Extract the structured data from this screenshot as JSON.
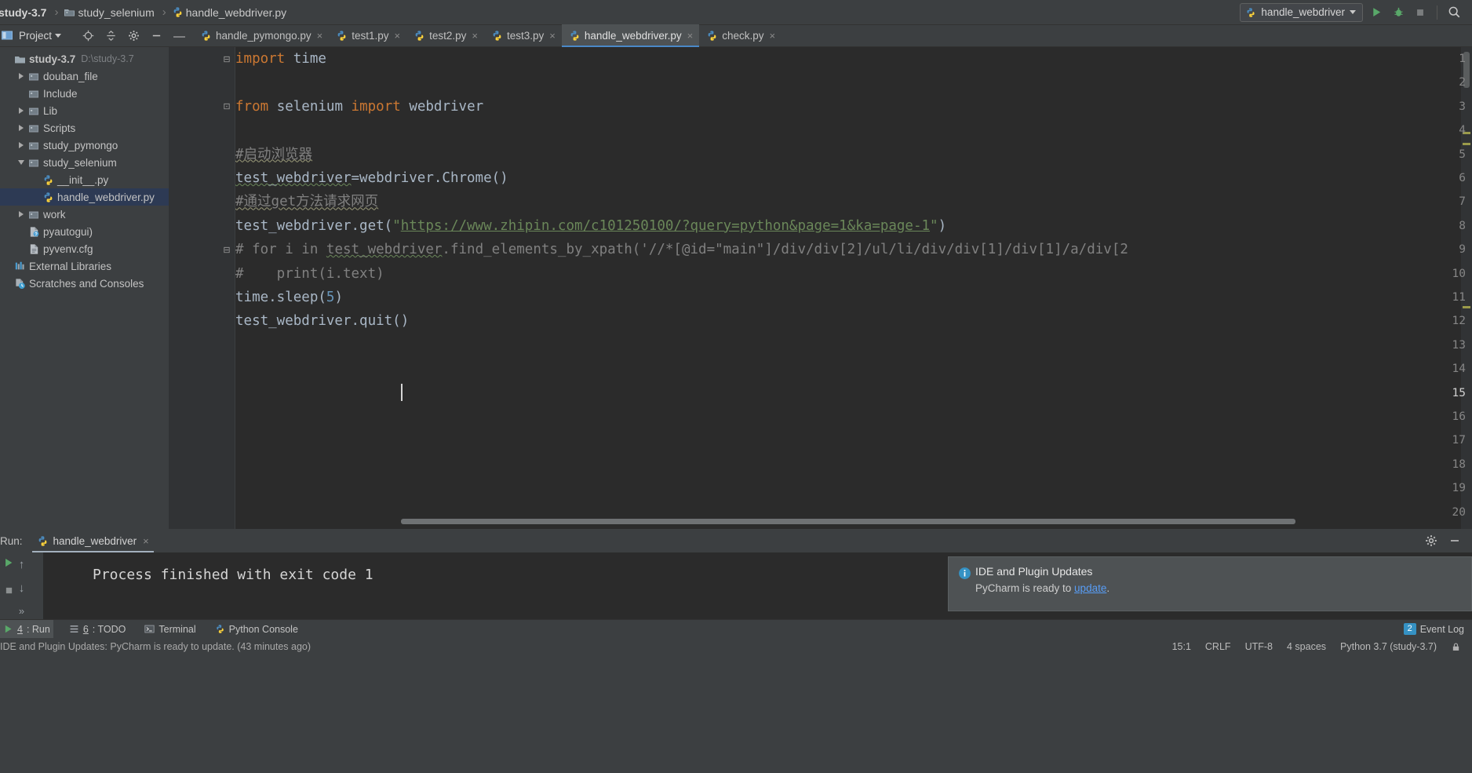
{
  "breadcrumb": {
    "items": [
      {
        "label": "study-3.7",
        "icon": "",
        "bold": true
      },
      {
        "label": "study_selenium",
        "icon": "folder-icon",
        "bold": false
      },
      {
        "label": "handle_webdriver.py",
        "icon": "python-file-icon",
        "bold": false
      }
    ],
    "separator": "›"
  },
  "navbar": {
    "run_config": "handle_webdriver",
    "run_button": "run-icon",
    "debug_button": "debug-icon",
    "stop_button": "stop-icon",
    "search_button": "search-icon"
  },
  "project_panel": {
    "title": "Project",
    "title_caret": "▼",
    "actions": [
      "locate-icon",
      "collapse-all-icon",
      "settings-gear-icon",
      "hide-icon"
    ],
    "tree": [
      {
        "label": "study-3.7",
        "path": "D:\\study-3.7",
        "icon": "folder-icon",
        "twist": "none",
        "indent": 0,
        "bold": true,
        "selected": false
      },
      {
        "label": "douban_file",
        "path": "",
        "icon": "module-folder-icon",
        "twist": "right",
        "indent": 1,
        "bold": false,
        "selected": false
      },
      {
        "label": "Include",
        "path": "",
        "icon": "module-folder-icon",
        "twist": "none",
        "indent": 1,
        "bold": false,
        "selected": false
      },
      {
        "label": "Lib",
        "path": "",
        "icon": "module-folder-icon",
        "twist": "right",
        "indent": 1,
        "bold": false,
        "selected": false
      },
      {
        "label": "Scripts",
        "path": "",
        "icon": "module-folder-icon",
        "twist": "right",
        "indent": 1,
        "bold": false,
        "selected": false
      },
      {
        "label": "study_pymongo",
        "path": "",
        "icon": "module-folder-icon",
        "twist": "right",
        "indent": 1,
        "bold": false,
        "selected": false
      },
      {
        "label": "study_selenium",
        "path": "",
        "icon": "module-folder-icon",
        "twist": "down",
        "indent": 1,
        "bold": false,
        "selected": false
      },
      {
        "label": "__init__.py",
        "path": "",
        "icon": "python-file-icon",
        "twist": "none",
        "indent": 2,
        "bold": false,
        "selected": false
      },
      {
        "label": "handle_webdriver.py",
        "path": "",
        "icon": "python-file-icon",
        "twist": "none",
        "indent": 2,
        "bold": false,
        "selected": true
      },
      {
        "label": "work",
        "path": "",
        "icon": "module-folder-icon",
        "twist": "right",
        "indent": 1,
        "bold": false,
        "selected": false
      },
      {
        "label": "pyautogui)",
        "path": "",
        "icon": "unknown-file-icon",
        "twist": "none",
        "indent": 1,
        "bold": false,
        "selected": false
      },
      {
        "label": "pyvenv.cfg",
        "path": "",
        "icon": "config-file-icon",
        "twist": "none",
        "indent": 1,
        "bold": false,
        "selected": false
      },
      {
        "label": "External Libraries",
        "path": "",
        "icon": "libraries-icon",
        "twist": "none",
        "indent": 0,
        "bold": false,
        "selected": false
      },
      {
        "label": "Scratches and Consoles",
        "path": "",
        "icon": "scratches-icon",
        "twist": "none",
        "indent": 0,
        "bold": false,
        "selected": false
      }
    ]
  },
  "editor": {
    "tabs": [
      {
        "label": "handle_pymongo.py",
        "active": false,
        "icon": "python-file-icon",
        "close": "×"
      },
      {
        "label": "test1.py",
        "active": false,
        "icon": "python-file-icon",
        "close": "×"
      },
      {
        "label": "test2.py",
        "active": false,
        "icon": "python-file-icon",
        "close": "×"
      },
      {
        "label": "test3.py",
        "active": false,
        "icon": "python-file-icon",
        "close": "×"
      },
      {
        "label": "handle_webdriver.py",
        "active": true,
        "icon": "python-file-icon",
        "close": "×"
      },
      {
        "label": "check.py",
        "active": false,
        "icon": "python-file-icon",
        "close": "×"
      }
    ],
    "line_numbers": [
      "1",
      "2",
      "3",
      "4",
      "5",
      "6",
      "7",
      "8",
      "9",
      "10",
      "11",
      "12",
      "13",
      "14",
      "15",
      "16",
      "17",
      "18",
      "19",
      "20"
    ],
    "current_line": "15",
    "code_lines": [
      {
        "n": 1,
        "text": "import time"
      },
      {
        "n": 2,
        "text": ""
      },
      {
        "n": 3,
        "text": "from selenium import webdriver"
      },
      {
        "n": 4,
        "text": ""
      },
      {
        "n": 5,
        "text": "#启动浏览器"
      },
      {
        "n": 6,
        "text": "test_webdriver=webdriver.Chrome()"
      },
      {
        "n": 7,
        "text": "#通过get方法请求网页"
      },
      {
        "n": 8,
        "text": "test_webdriver.get(\"https://www.zhipin.com/c101250100/?query=python&page=1&ka=page-1\")"
      },
      {
        "n": 9,
        "text": "# for i in test_webdriver.find_elements_by_xpath('//*[@id=\"main\"]/div/div[2]/ul/li/div/div[1]/div[1]/a/div[2"
      },
      {
        "n": 10,
        "text": "#    print(i.text)"
      },
      {
        "n": 11,
        "text": "time.sleep(5)"
      },
      {
        "n": 12,
        "text": "test_webdriver.quit()"
      },
      {
        "n": 13,
        "text": ""
      },
      {
        "n": 14,
        "text": ""
      },
      {
        "n": 15,
        "text": ""
      },
      {
        "n": 16,
        "text": ""
      },
      {
        "n": 17,
        "text": ""
      },
      {
        "n": 18,
        "text": ""
      },
      {
        "n": 19,
        "text": ""
      },
      {
        "n": 20,
        "text": ""
      }
    ]
  },
  "run_panel": {
    "label": "Run:",
    "tab_title": "handle_webdriver",
    "tab_close": "×",
    "console_text": "Process finished with exit code 1",
    "settings_icon": "gear-icon",
    "hide_icon": "minimize-icon",
    "toolbar_icons": [
      "rerun-icon",
      "stop-icon",
      "up-arrow-icon",
      "down-arrow-icon",
      "soft-wrap-icon",
      "expand-icon"
    ]
  },
  "balloon": {
    "title": "IDE and Plugin Updates",
    "body_before": "PyCharm is ready to ",
    "link": "update",
    "body_after": ".",
    "icon": "info-icon"
  },
  "tool_window_bar": {
    "items": [
      {
        "num": "4",
        "label": ": Run",
        "icon": "run-icon",
        "active": true
      },
      {
        "num": "6",
        "label": ": TODO",
        "icon": "todo-icon",
        "active": false
      },
      {
        "num": "",
        "label": "Terminal",
        "icon": "terminal-icon",
        "active": false
      },
      {
        "num": "",
        "label": "Python Console",
        "icon": "python-icon",
        "active": false
      }
    ],
    "event_log": {
      "label": "Event Log",
      "count": "2",
      "icon": "event-log-icon"
    }
  },
  "status_bar": {
    "message": "IDE and Plugin Updates: PyCharm is ready to update. (43 minutes ago)",
    "caret_position": "15:1",
    "line_separator": "CRLF",
    "encoding": "UTF-8",
    "indent": "4 spaces",
    "interpreter": "Python 3.7 (study-3.7)",
    "lock_icon": "lock-icon"
  },
  "colors": {
    "accent_blue": "#4a88c7",
    "selection_blue": "#2d3a54",
    "link_blue": "#589df6",
    "keyword_orange": "#cc7832",
    "string_green": "#6a8759",
    "comment_gray": "#808080",
    "number_blue": "#6897bb",
    "editor_bg": "#2b2b2b",
    "panel_bg": "#3c3f41"
  }
}
